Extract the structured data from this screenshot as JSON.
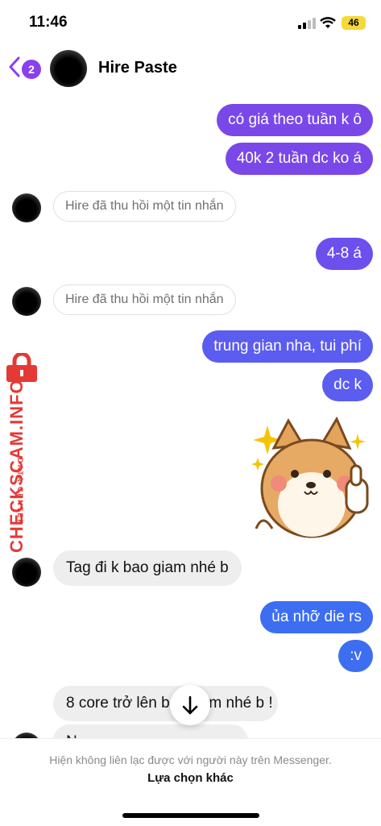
{
  "status": {
    "time": "11:46",
    "battery": "46"
  },
  "header": {
    "back_badge": "2",
    "contact_name": "Hire Paste"
  },
  "messages": {
    "m1": "có giá theo tuần k ô",
    "m2": "40k 2 tuần dc ko á",
    "unsent1": "Hire đã thu hồi một tin nhắn",
    "m3": "4-8 á",
    "unsent2": "Hire đã thu hồi một tin nhắn",
    "m4": "trung gian nha, tui phí",
    "m5": "dc k",
    "m6": "Tag đi k bao giam nhé b",
    "m7": "ủa nhỡ die rs",
    "m8": ":v",
    "m9": "8 core trở lên b",
    "m9b": "iam nhé b !",
    "m10": "N"
  },
  "watermark": {
    "brand": "CHECKSCAM.INFO",
    "sub": "DATA CENTER"
  },
  "footer": {
    "notice": "Hiện không liên lạc được với người này trên Messenger.",
    "action": "Lựa chọn khác"
  },
  "colors": {
    "purple": "#7a48e8",
    "blue_purple": "#5b5cf0",
    "blue": "#3d6ef2",
    "watermark_red": "#e53935"
  }
}
